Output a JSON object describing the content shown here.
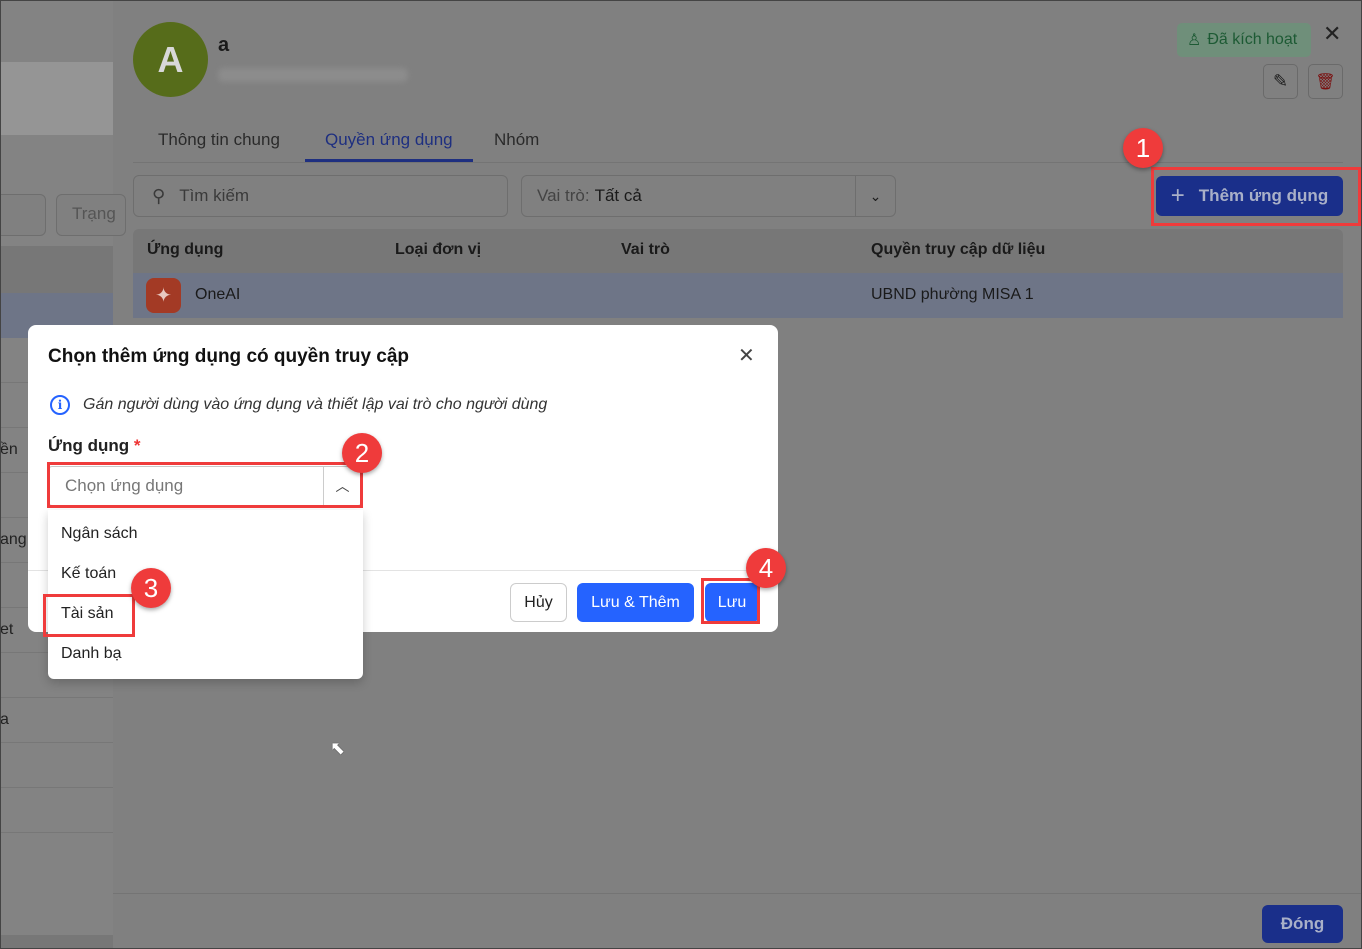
{
  "left_partial": {
    "filter_label": "Trạng",
    "rows": [
      "ền",
      "ang",
      "et",
      "a"
    ]
  },
  "user": {
    "avatar_letter": "A",
    "name": "a",
    "status": "Đã kích hoạt"
  },
  "tabs": [
    "Thông tin chung",
    "Quyền ứng dụng",
    "Nhóm"
  ],
  "active_tab": "Quyền ứng dụng",
  "search": {
    "placeholder": "Tìm kiếm"
  },
  "role_filter": {
    "label": "Vai trò:",
    "value": "Tất cả"
  },
  "add_app_button": "Thêm ứng dụng",
  "table": {
    "headers": [
      "Ứng dụng",
      "Loại đơn vị",
      "Vai trò",
      "Quyền truy cập dữ liệu"
    ],
    "rows": [
      {
        "app": "OneAI",
        "unit_type": "",
        "role": "",
        "data_access": "UBND phường MISA 1"
      }
    ]
  },
  "dialog": {
    "title": "Chọn thêm ứng dụng có quyền truy cập",
    "info": "Gán người dùng vào ứng dụng và thiết lập vai trò cho người dùng",
    "field_label": "Ứng dụng",
    "required_mark": "*",
    "select_placeholder": "Chọn ứng dụng",
    "options": [
      "Ngân sách",
      "Kế toán",
      "Tài sản",
      "Danh bạ"
    ],
    "cancel": "Hủy",
    "save_add": "Lưu & Thêm",
    "save": "Lưu"
  },
  "callouts": [
    "1",
    "2",
    "3",
    "4"
  ],
  "close_button": "Đóng",
  "colors": {
    "primary": "#2563ff",
    "callout": "#ef3b3b"
  }
}
